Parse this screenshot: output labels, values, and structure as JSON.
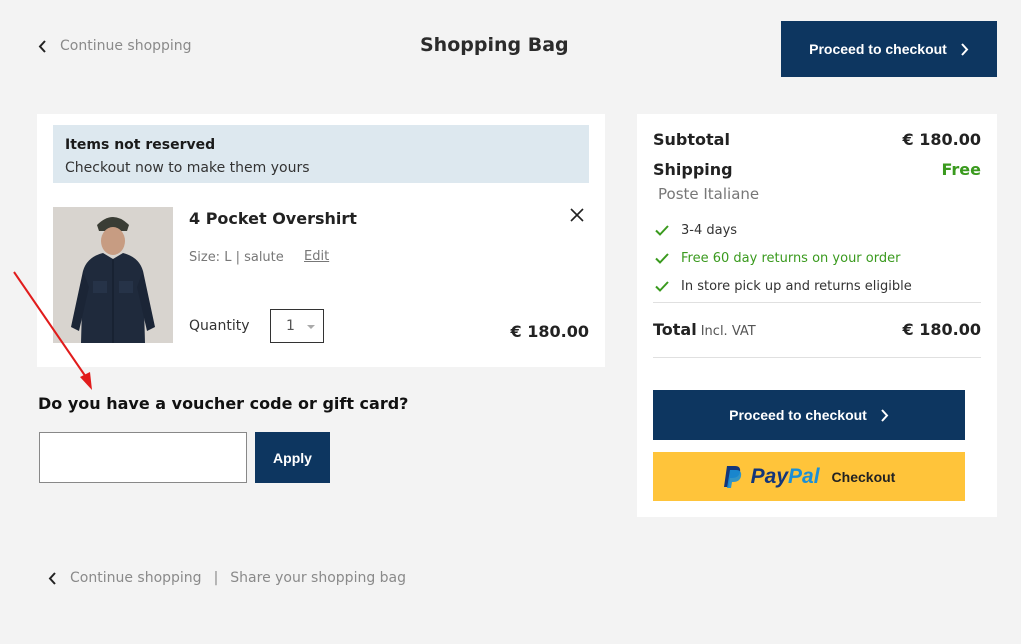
{
  "header": {
    "continue_label": "Continue shopping",
    "title": "Shopping Bag",
    "checkout_label": "Proceed to checkout"
  },
  "reserve_notice": {
    "title": "Items not reserved",
    "subtitle": "Checkout now to make them yours"
  },
  "cart_item": {
    "name": "4 Pocket Overshirt",
    "size_text": "Size: L | salute",
    "edit_label": "Edit",
    "quantity_label": "Quantity",
    "quantity_value": "1",
    "price": "€ 180.00"
  },
  "voucher": {
    "title": "Do you have a voucher code or gift card?",
    "input_value": "",
    "apply_label": "Apply"
  },
  "summary": {
    "subtotal_label": "Subtotal",
    "subtotal_value": "€ 180.00",
    "shipping_label": "Shipping",
    "shipping_value": "Free",
    "carrier": "Poste Italiane",
    "perks": [
      "3-4 days",
      "Free 60 day returns on your order",
      "In store pick up and returns eligible"
    ],
    "total_label": "Total",
    "total_note": "Incl. VAT",
    "total_value": "€ 180.00",
    "checkout_label": "Proceed to checkout",
    "paypal_pay": "Pay",
    "paypal_pal": "Pal",
    "paypal_checkout_label": "Checkout"
  },
  "footer": {
    "continue_label": "Continue shopping",
    "separator": "|",
    "share_label": "Share your shopping bag"
  },
  "colors": {
    "brand_navy": "#0d3660",
    "success_green": "#3a9a1e",
    "paypal_yellow": "#ffc43a",
    "annotation_red": "#e11c1c"
  },
  "icons": {
    "back": "chevron-left-icon",
    "forward": "chevron-right-icon",
    "remove": "close-icon",
    "check": "check-icon",
    "paypal": "paypal-logo-icon"
  }
}
